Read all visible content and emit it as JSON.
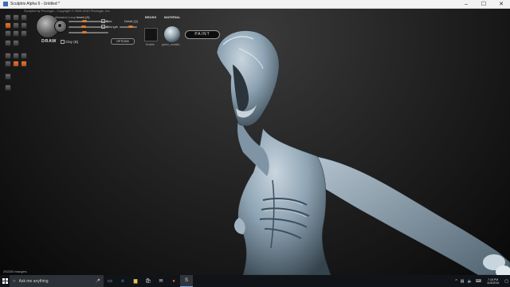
{
  "window": {
    "title": "Sculptris Alpha 6 - Untitled *",
    "controls": {
      "minimize": "–",
      "maximize": "☐",
      "close": "✕"
    }
  },
  "menu_line": "Sculptris by Pixologic - Copyright © 2009-2010 Pixologic, Inc.",
  "tabs": {
    "left": "Abrasion",
    "middle": "Loop",
    "right": "Invert (X)"
  },
  "draw": {
    "label": "DRAW"
  },
  "params": {
    "size_label": "Size",
    "strength_label": "Strength",
    "detail_label": "Detail (Q)",
    "clay_label": "Clay (B)",
    "options_label": "OPTIONS",
    "size_value": 0.55,
    "strength_value": 0.4
  },
  "brush": {
    "heading": "BRUSH",
    "sub": "Enable"
  },
  "material": {
    "heading": "MATERIAL",
    "name": "green_metallic"
  },
  "paint_button": "PAINT",
  "status": {
    "triangles": "292200 triangles"
  },
  "taskbar": {
    "search_placeholder": "Ask me anything",
    "time": "7:18 PM",
    "date": "11/5/2016",
    "tray_caret": "^"
  },
  "colors": {
    "accent": "#e07a2a",
    "sculpt_material": "#8ea4b4"
  }
}
